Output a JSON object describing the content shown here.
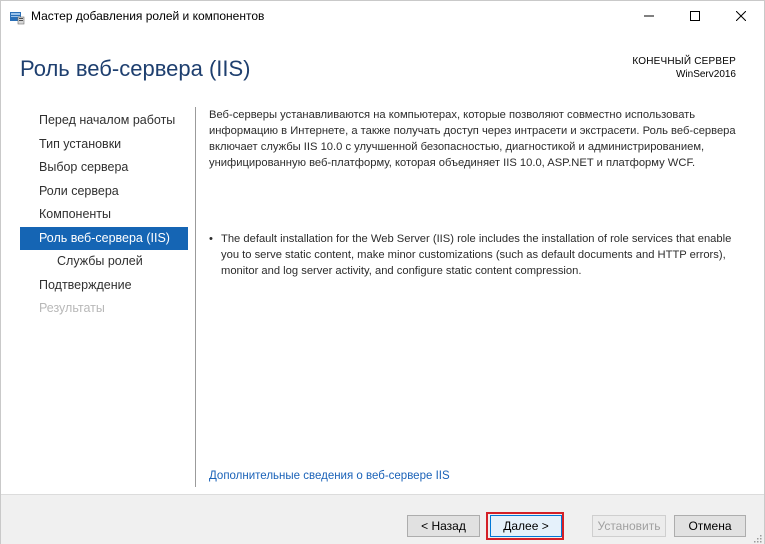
{
  "window": {
    "title": "Мастер добавления ролей и компонентов"
  },
  "header": {
    "page_title": "Роль веб-сервера (IIS)",
    "destination_label": "КОНЕЧНЫЙ СЕРВЕР",
    "destination_server": "WinServ2016"
  },
  "nav": {
    "items": [
      {
        "label": "Перед началом работы"
      },
      {
        "label": "Тип установки"
      },
      {
        "label": "Выбор сервера"
      },
      {
        "label": "Роли сервера"
      },
      {
        "label": "Компоненты"
      },
      {
        "label": "Роль веб-сервера (IIS)"
      },
      {
        "label": "Службы ролей"
      },
      {
        "label": "Подтверждение"
      },
      {
        "label": "Результаты"
      }
    ]
  },
  "content": {
    "intro": "Веб-серверы устанавливаются на компьютерах, которые позволяют совместно использовать информацию в Интернете, а также получать доступ через интрасети и экстрасети. Роль веб-сервера включает службы IIS 10.0 с улучшенной безопасностью, диагностикой и администрированием, унифицированную веб-платформу, которая объединяет IIS 10.0, ASP.NET и платформу WCF.",
    "bullet_symbol": "•",
    "bullet": "The default installation for the Web Server (IIS) role includes the installation of role services that enable you to serve static content, make minor customizations (such as default documents and HTTP errors), monitor and log server activity, and configure static content compression.",
    "more_link": "Дополнительные сведения о веб-сервере IIS"
  },
  "footer": {
    "prev_label": "< Назад",
    "next_label": "Далее >",
    "install_label": "Установить",
    "cancel_label": "Отмена"
  },
  "colors": {
    "accent": "#1565b4",
    "title": "#1e3f6f",
    "link": "#1a62b8",
    "highlight": "#d42027"
  }
}
